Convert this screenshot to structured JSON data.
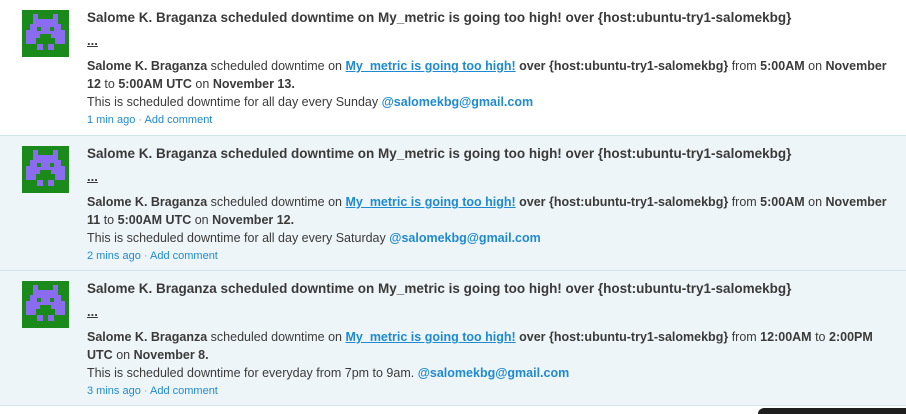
{
  "colors": {
    "link": "#1f8ad0",
    "avatar_bg": "#1a8a1a",
    "avatar_fg": "#8b6cf0",
    "highlight_bg": "#eef5f9"
  },
  "events": [
    {
      "title": "Salome K. Braganza scheduled downtime on My_metric is going too high! over {host:ubuntu-try1-salomekbg}",
      "more": "...",
      "user": "Salome K. Braganza",
      "action": "scheduled downtime on",
      "monitor": "My_metric is going too high!",
      "over": "over {host:ubuntu-try1-salomekbg}",
      "from_word": "from",
      "start_time": "5:00AM",
      "on1": "on",
      "start_date": "November 12",
      "to_word": "to",
      "end_time": "5:00AM UTC",
      "on2": "on",
      "end_date": "November 13.",
      "message": "This is scheduled downtime for all day every Sunday",
      "mention": "@salomekbg@gmail.com",
      "ago": "1 min ago",
      "sep": "·",
      "add_comment": "Add comment",
      "avatar_icon": "space-invader-icon"
    },
    {
      "title": "Salome K. Braganza scheduled downtime on My_metric is going too high! over {host:ubuntu-try1-salomekbg}",
      "more": "...",
      "user": "Salome K. Braganza",
      "action": "scheduled downtime on",
      "monitor": "My_metric is going too high!",
      "over": "over {host:ubuntu-try1-salomekbg}",
      "from_word": "from",
      "start_time": "5:00AM",
      "on1": "on",
      "start_date": "November 11",
      "to_word": "to",
      "end_time": "5:00AM UTC",
      "on2": "on",
      "end_date": "November 12.",
      "message": "This is scheduled downtime for all day every Saturday",
      "mention": "@salomekbg@gmail.com",
      "ago": "2 mins ago",
      "sep": "·",
      "add_comment": "Add comment",
      "avatar_icon": "space-invader-icon"
    },
    {
      "title": "Salome K. Braganza scheduled downtime on My_metric is going too high! over {host:ubuntu-try1-salomekbg}",
      "more": "...",
      "user": "Salome K. Braganza",
      "action": "scheduled downtime on",
      "monitor": "My_metric is going too high!",
      "over": "over {host:ubuntu-try1-salomekbg}",
      "from_word": "from",
      "start_time": "12:00AM",
      "on1": "",
      "start_date": "",
      "to_word": "to",
      "end_time": "2:00PM UTC",
      "on2": "on",
      "end_date": "November 8.",
      "message": "This is scheduled downtime for everyday from 7pm to 9am.",
      "mention": "@salomekbg@gmail.com",
      "ago": "3 mins ago",
      "sep": "·",
      "add_comment": "Add comment",
      "avatar_icon": "space-invader-icon"
    }
  ]
}
